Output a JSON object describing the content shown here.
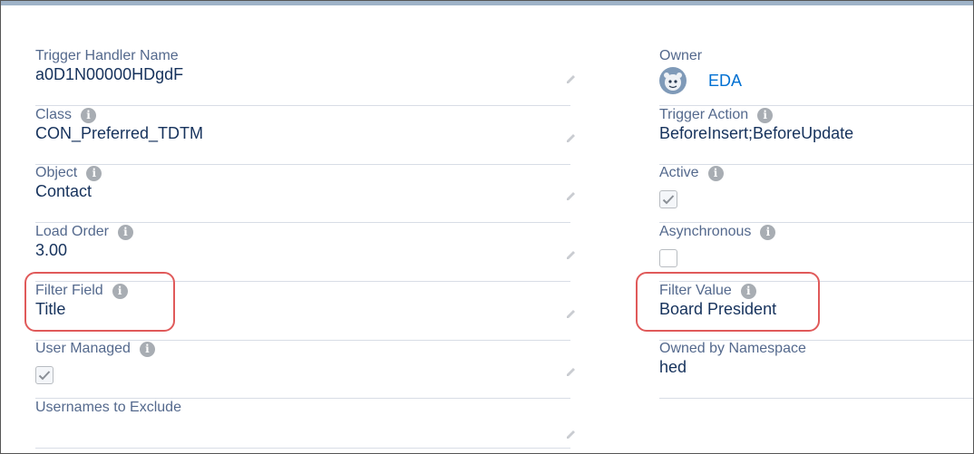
{
  "left_fields": [
    {
      "label": "Trigger Handler Name",
      "value": "a0D1N00000HDgdF",
      "info": false
    },
    {
      "label": "Class",
      "value": "CON_Preferred_TDTM",
      "info": true
    },
    {
      "label": "Object",
      "value": "Contact",
      "info": true
    },
    {
      "label": "Load Order",
      "value": "3.00",
      "info": true
    },
    {
      "label": "Filter Field",
      "value": "Title",
      "info": true
    },
    {
      "label": "User Managed",
      "checked": true,
      "info": true
    },
    {
      "label": "Usernames to Exclude",
      "value": "",
      "info": false
    }
  ],
  "right_fields": [
    {
      "label": "Owner",
      "value": "EDA",
      "info": false
    },
    {
      "label": "Trigger Action",
      "value": "BeforeInsert;BeforeUpdate",
      "info": true
    },
    {
      "label": "Active",
      "checked": true,
      "info": true
    },
    {
      "label": "Asynchronous",
      "checked": false,
      "info": true
    },
    {
      "label": "Filter Value",
      "value": "Board President",
      "info": true
    },
    {
      "label": "Owned by Namespace",
      "value": "hed",
      "info": false
    }
  ],
  "info_glyph": "i",
  "icons": {
    "info": "info-icon",
    "edit": "pencil-icon",
    "check": "checkmark-icon",
    "avatar": "user-avatar-icon"
  },
  "colors": {
    "label": "#54698d",
    "value": "#16325c",
    "link": "#0070d2",
    "highlight": "#e05a5a",
    "divider": "#d8dde6"
  }
}
